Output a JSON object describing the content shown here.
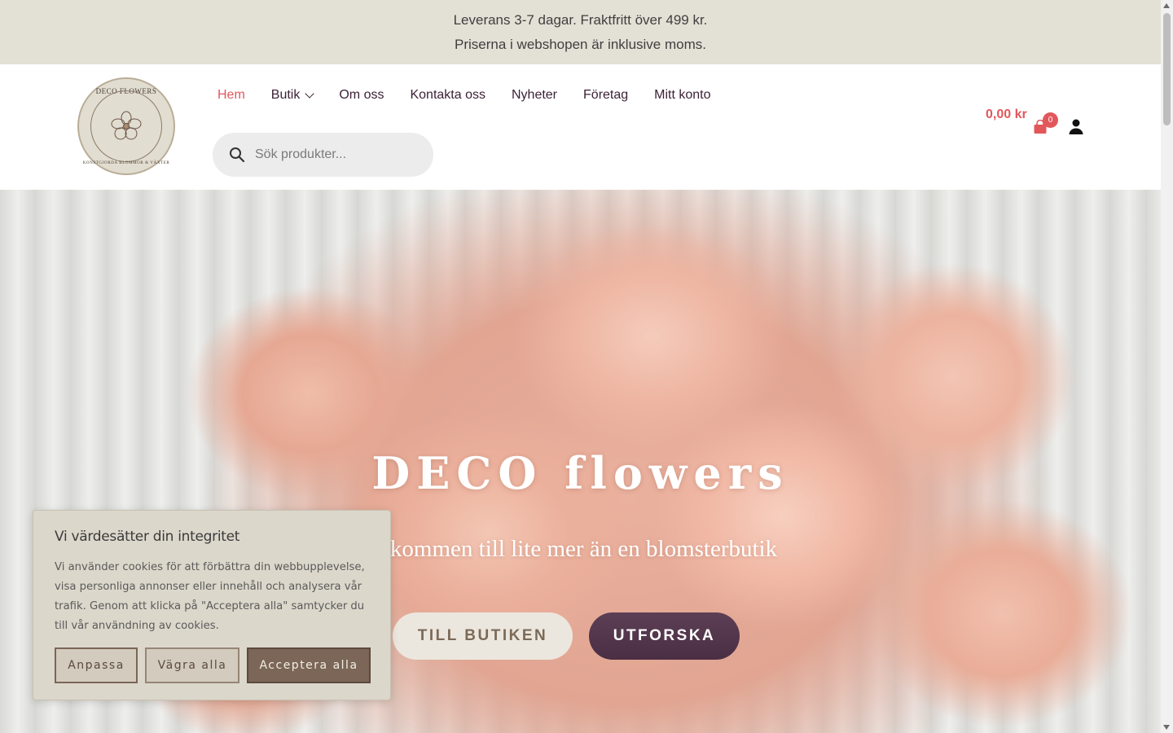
{
  "topbar": {
    "line1": "Leverans 3-7 dagar. Fraktfritt över 499 kr.",
    "line2": "Priserna i webshopen är inklusive moms."
  },
  "logo": {
    "title": "DECO FLOWERS",
    "subtitle": "KONSTGJORDA BLOMMOR & VÄXTER"
  },
  "nav": {
    "items": [
      {
        "label": "Hem",
        "active": true
      },
      {
        "label": "Butik",
        "has_dropdown": true
      },
      {
        "label": "Om oss"
      },
      {
        "label": "Kontakta oss"
      },
      {
        "label": "Nyheter"
      },
      {
        "label": "Företag"
      },
      {
        "label": "Mitt konto"
      }
    ]
  },
  "search": {
    "placeholder": "Sök produkter...",
    "icon": "search-icon"
  },
  "cart": {
    "total": "0,00 kr",
    "count": "0",
    "icon": "shopping-bag-icon"
  },
  "account": {
    "icon": "user-icon"
  },
  "hero": {
    "title": "DECO flowers",
    "subtitle": "lkommen till lite mer än en blomsterbutik",
    "primary_button": "TILL BUTIKEN",
    "secondary_button": "UTFORSKA"
  },
  "cookie_banner": {
    "title": "Vi värdesätter din integritet",
    "text": "Vi använder cookies för att förbättra din webbupplevelse, visa personliga annonser eller innehåll och analysera vår trafik. Genom att klicka på \"Acceptera alla\" samtycker du till vår användning av cookies.",
    "customize": "Anpassa",
    "reject": "Vägra alla",
    "accept": "Acceptera alla"
  },
  "colors": {
    "accent": "#e2575b",
    "nav_text": "#3c2236",
    "topbar_bg": "#e3e1d6",
    "explore_button": "#4e3247",
    "cookie_bg": "#dcd7cb"
  }
}
